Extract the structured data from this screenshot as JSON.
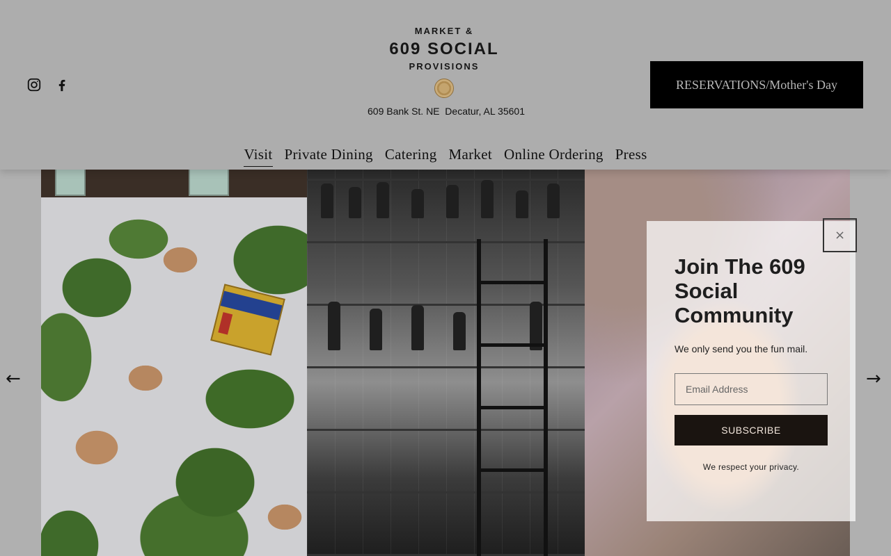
{
  "header": {
    "social": [
      {
        "icon": "instagram-icon"
      },
      {
        "icon": "facebook-icon"
      }
    ],
    "logo": {
      "line1": "MARKET &",
      "line2": "609 SOCIAL",
      "line3": "PROVISIONS"
    },
    "address": "609 Bank St. NE  Decatur, AL 35601",
    "reservation_button": "RESERVATIONS/Mother's Day"
  },
  "nav": {
    "items": [
      "Visit",
      "Private Dining",
      "Catering",
      "Market",
      "Online Ordering",
      "Press"
    ],
    "active": "Visit"
  },
  "gallery": {
    "prev_icon": "←",
    "next_icon": "→",
    "slides": [
      "seafood-on-ice",
      "bar-shelves",
      "cocktail-glass"
    ]
  },
  "popup": {
    "close": "×",
    "title": "Join The 609 Social Community",
    "subtitle": "We only send you the fun mail.",
    "email_placeholder": "Email Address",
    "subscribe": "SUBSCRIBE",
    "privacy": "We respect your privacy."
  },
  "colors": {
    "overlay_bg": "#b0b0b0",
    "button_bg": "#000000",
    "subscribe_bg": "#1a1410"
  }
}
